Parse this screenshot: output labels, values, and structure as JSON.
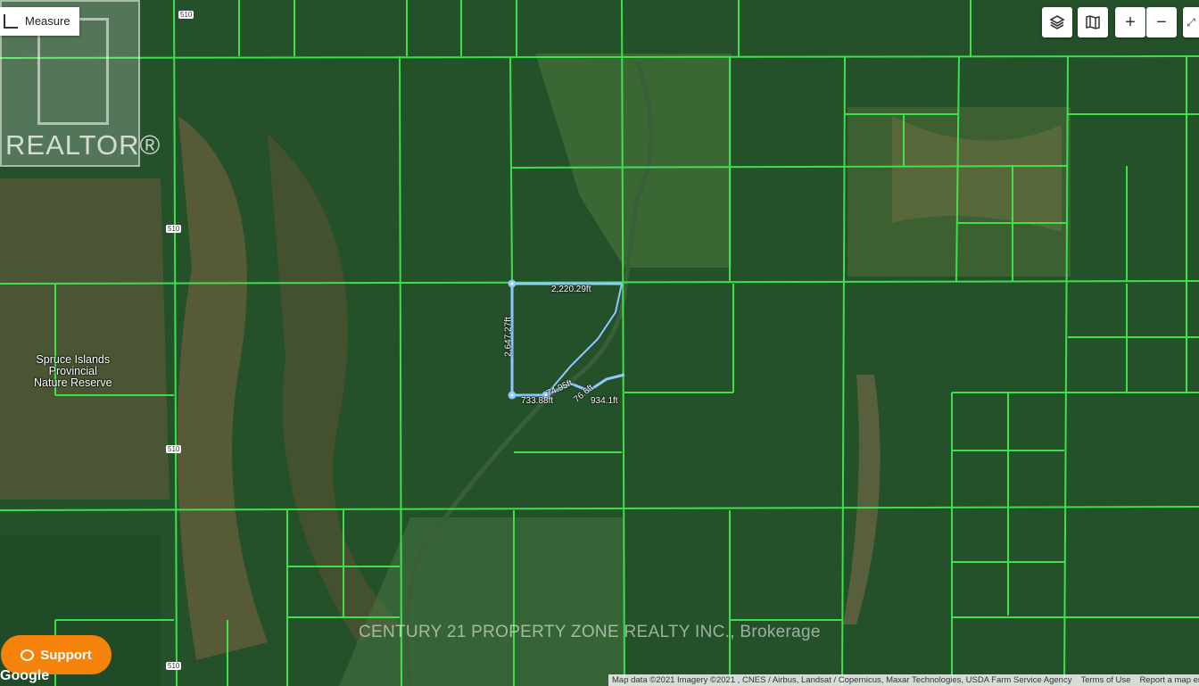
{
  "toolbar": {
    "measure_label": "Measure",
    "layers_icon": "layers-icon",
    "map_type_icon": "map-type-icon",
    "zoom_in_label": "+",
    "zoom_out_label": "−"
  },
  "branding": {
    "realtor_text": "REALTOR®",
    "watermark": "CENTURY 21 PROPERTY ZONE REALTY INC., Brokerage"
  },
  "place_label": [
    "Spruce Islands",
    "Provincial",
    "Nature Reserve"
  ],
  "highway_shield": "510",
  "measurements": {
    "top_side": "2,220.29ft",
    "left_side": "2,647.27ft",
    "bottom_a": "733.88ft",
    "bottom_b": "74.95ft",
    "bottom_c": "76.6ft",
    "bottom_d": "934.1ft"
  },
  "support_label": "Support",
  "google_logo": "Google",
  "attribution": {
    "map_data": "Map data ©2021 Imagery ©2021 , CNES / Airbus, Landsat / Copernicus, Maxar Technologies, USDA Farm Service Agency",
    "terms": "Terms of Use",
    "report": "Report a map error"
  },
  "colors": {
    "parcel_line": "#3ff04f",
    "boundary": "#8ec9ff",
    "support_bg": "#f5820a"
  }
}
